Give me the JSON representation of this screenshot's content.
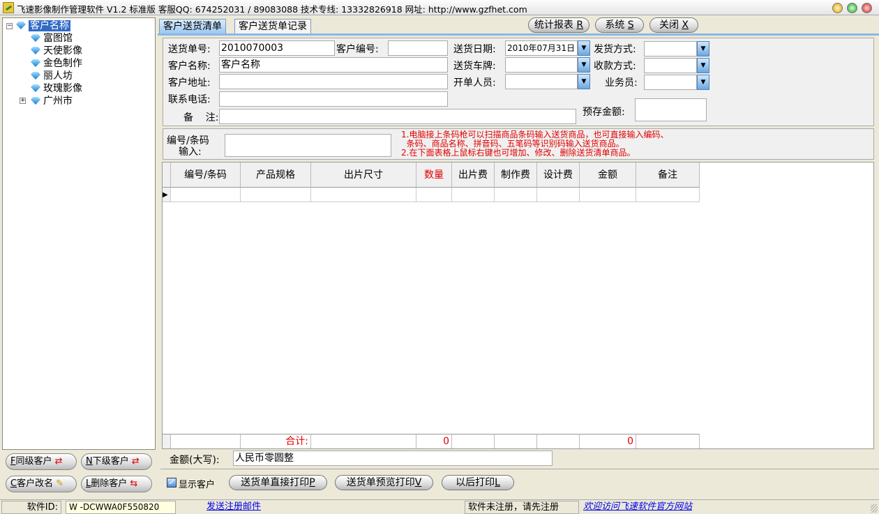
{
  "window": {
    "title": "飞速影像制作管理软件 V1.2 标准版 客服QQ: 674252031 / 89083088  技术专线: 13332826918 网址: http://www.gzfhet.com"
  },
  "tree": {
    "root": "客户名称",
    "children": [
      "富图馆",
      "天使影像",
      "金色制作",
      "丽人坊",
      "玫瑰影像",
      "广州市"
    ]
  },
  "left_buttons": {
    "same_level": "同级客户",
    "sub_level": "下级客户",
    "rename": "客户改名",
    "delete": "删除客户",
    "same_key": "F",
    "sub_key": "N",
    "rename_key": "C",
    "delete_key": "L"
  },
  "tabs": [
    "客户送货清单",
    "客户送货单记录"
  ],
  "top_buttons": {
    "report": "统计报表",
    "report_key": "R",
    "system": "系统",
    "system_key": "S",
    "close": "关闭",
    "close_key": "X"
  },
  "form": {
    "order_no_label": "送货单号:",
    "order_no": "2010070003",
    "cust_no_label": "客户编号:",
    "cust_no": "",
    "cust_name_label": "客户名称:",
    "cust_name": "客户名称",
    "address_label": "客户地址:",
    "address": "",
    "phone_label": "联系电话:",
    "phone": "",
    "note_label": "备    注:",
    "note": "",
    "date_label": "送货日期:",
    "date": "2010年07月31日",
    "plate_label": "送货车牌:",
    "plate": "",
    "issuer_label": "开单人员:",
    "issuer": "",
    "ship_label": "发货方式:",
    "ship": "",
    "pay_label": "收款方式:",
    "pay": "",
    "sales_label": "业务员:",
    "sales": "",
    "deposit_label": "预存金额:",
    "deposit": ""
  },
  "barcode": {
    "label1": "编号/条码",
    "label2": "输入:",
    "value": "",
    "tips": [
      "1.电脑接上条码枪可以扫描商品条码输入送货商品，也可直接输入编码、",
      "  条码、商品名称、拼音码、五笔码等识别码输入送货商品。",
      "2.在下面表格上鼠标右键也可增加、修改、删除送货清单商品。"
    ]
  },
  "grid": {
    "columns": [
      "编号/条码",
      "产品规格",
      "出片尺寸",
      "数量",
      "出片费",
      "制作费",
      "设计费",
      "金额",
      "备注"
    ],
    "total_label": "合计:",
    "total_qty": "0",
    "total_amount": "0"
  },
  "amount": {
    "label": "金额(大写):",
    "value": "人民币零圆整"
  },
  "bottom": {
    "show_customer": "显示客户",
    "print_direct": "送货单直接打印",
    "print_direct_key": "P",
    "print_preview": "送货单预览打印",
    "print_preview_key": "V",
    "print_later": "以后打印",
    "print_later_key": "L"
  },
  "status": {
    "id_label": "软件ID:",
    "id_value": "W -DCWWA0F550820",
    "send_mail": "发送注册邮件",
    "unregistered": "软件未注册，请先注册",
    "visit": "欢迎访问飞速软件官方网站"
  },
  "colors": {
    "accent": "#316ac5",
    "red": "#e00000"
  }
}
